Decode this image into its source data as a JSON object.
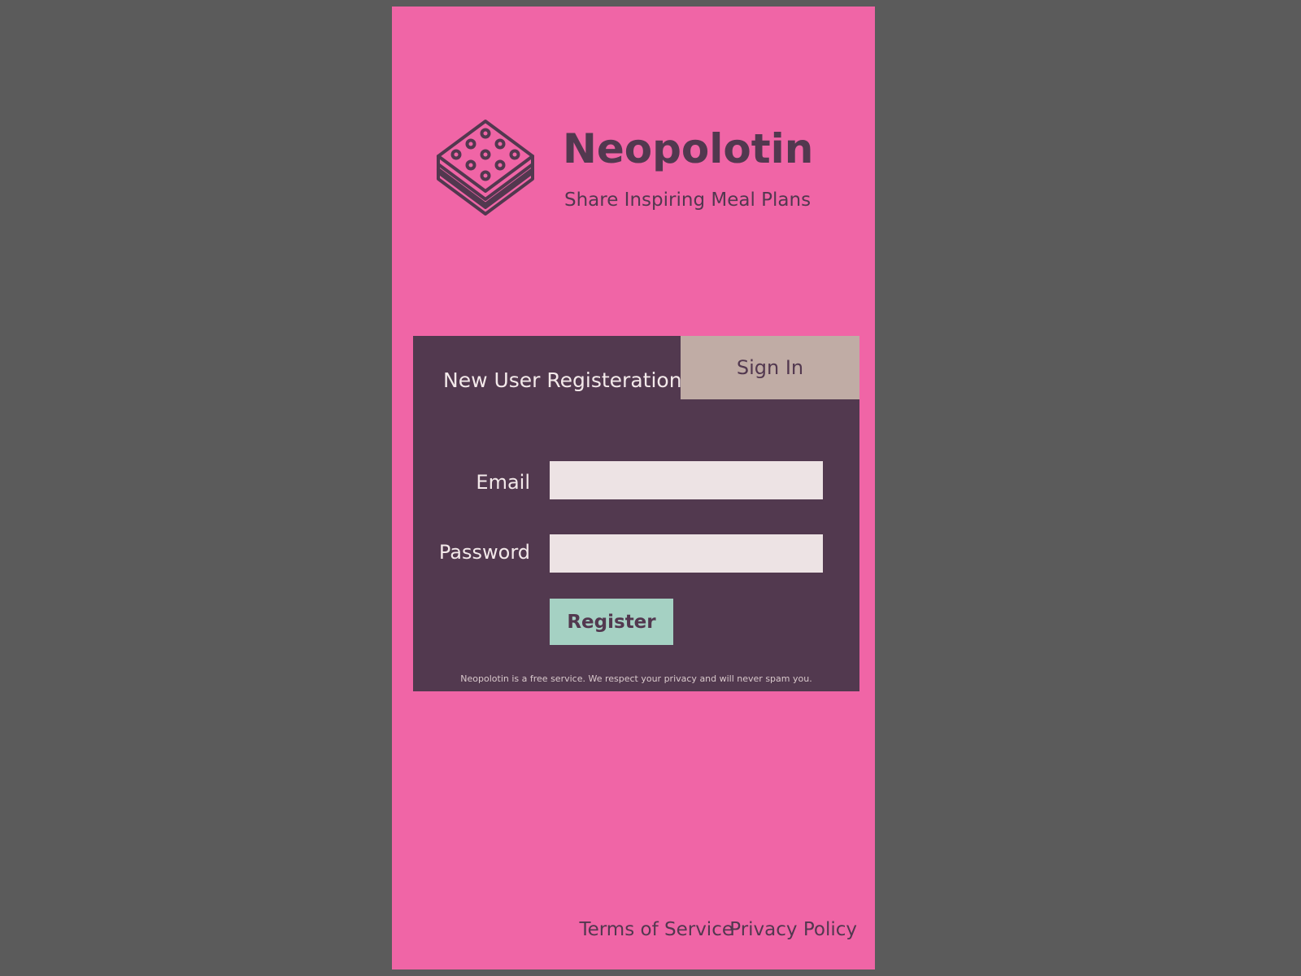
{
  "brand": {
    "name": "Neopolotin",
    "tagline": "Share Inspiring Meal Plans",
    "logo_icon": "sandwich-cookie-icon"
  },
  "auth": {
    "active_tab_label": "New User Registeration",
    "signin_tab_label": "Sign In",
    "fields": {
      "email_label": "Email",
      "email_value": "",
      "password_label": "Password",
      "password_value": ""
    },
    "register_label": "Register",
    "disclaimer": "Neopolotin is a free service. We respect your privacy and will never spam you."
  },
  "footer": {
    "terms_label": "Terms of Service",
    "privacy_label": "Privacy Policy"
  },
  "colors": {
    "outer_background": "#5b5b5b",
    "page_background": "#f065a6",
    "card_background": "#52394f",
    "brand_text": "#52384f",
    "signin_tab": "#c0aca5",
    "input_background": "#ede3e4",
    "register_button": "#a5d1c3"
  }
}
